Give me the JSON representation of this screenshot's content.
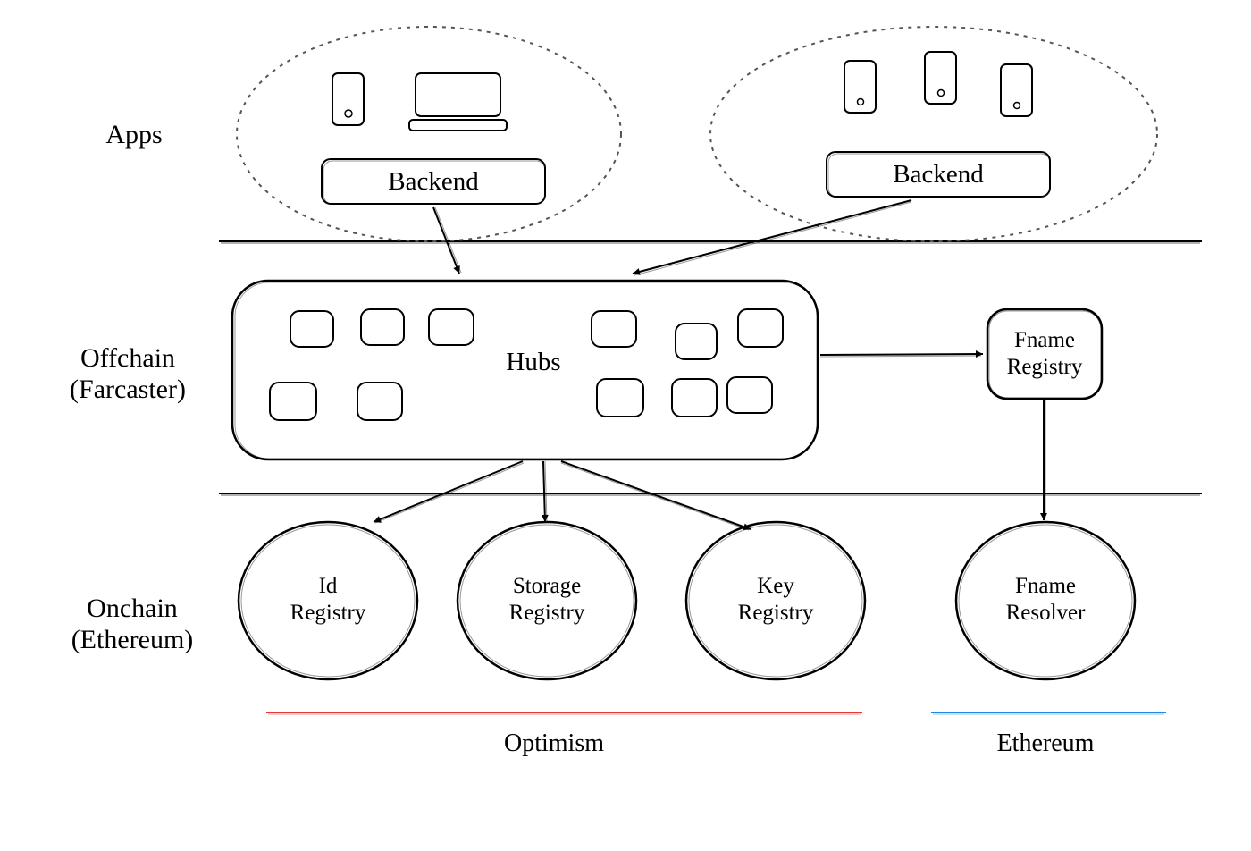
{
  "layers": {
    "apps": "Apps",
    "offchain_line1": "Offchain",
    "offchain_line2": "(Farcaster)",
    "onchain_line1": "Onchain",
    "onchain_line2": "(Ethereum)"
  },
  "nodes": {
    "backend_left": "Backend",
    "backend_right": "Backend",
    "hubs": "Hubs",
    "fname_registry": "Fname\nRegistry",
    "id_registry": "Id\nRegistry",
    "storage_registry": "Storage\nRegistry",
    "key_registry": "Key\nRegistry",
    "fname_resolver": "Fname\nResolver"
  },
  "chains": {
    "optimism": "Optimism",
    "ethereum": "Ethereum"
  },
  "colors": {
    "optimism": "#e53935",
    "ethereum": "#1e88e5"
  }
}
